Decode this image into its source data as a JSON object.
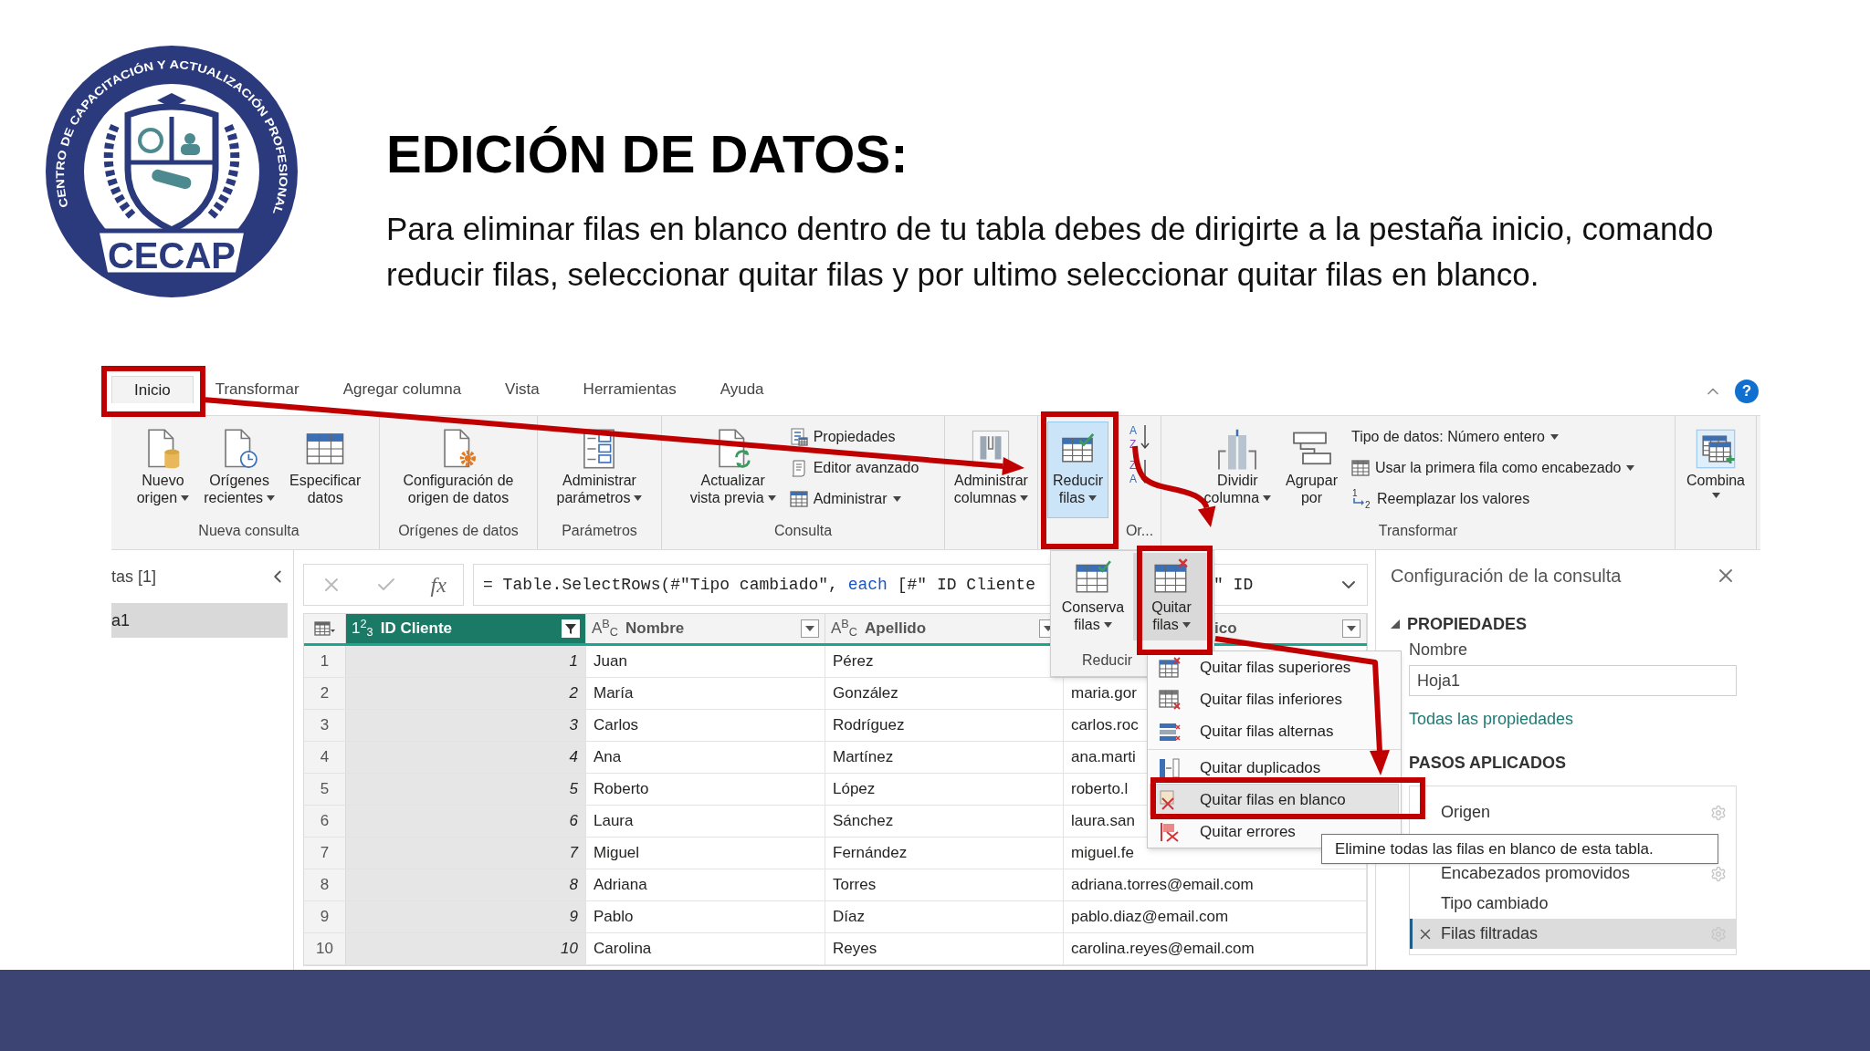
{
  "slide": {
    "title": "EDICIÓN DE DATOS:",
    "body": "Para eliminar filas en blanco dentro de tu tabla debes de dirigirte a la pestaña inicio, comando reducir filas, seleccionar quitar filas y por ultimo seleccionar quitar filas en blanco."
  },
  "logo": {
    "ring_text": "CENTRO DE CAPACITACIÓN Y ACTUALIZACIÓN PROFESIONAL",
    "wordmark": "CECAP"
  },
  "tabs": [
    {
      "label": "Inicio",
      "selected": true
    },
    {
      "label": "Transformar",
      "selected": false
    },
    {
      "label": "Agregar columna",
      "selected": false
    },
    {
      "label": "Vista",
      "selected": false
    },
    {
      "label": "Herramientas",
      "selected": false
    },
    {
      "label": "Ayuda",
      "selected": false
    }
  ],
  "help_label": "?",
  "ribbon": {
    "groups": [
      {
        "kind": "standard",
        "label": "Nueva consulta",
        "buttons": [
          {
            "lines": [
              "Nuevo",
              "origen"
            ],
            "dropdown": true,
            "pressed": false
          },
          {
            "lines": [
              "Orígenes",
              "recientes"
            ],
            "dropdown": true,
            "pressed": false
          },
          {
            "lines": [
              "Especificar",
              "datos"
            ],
            "dropdown": false,
            "pressed": false
          }
        ]
      },
      {
        "kind": "standard",
        "label": "Orígenes de datos",
        "buttons": [
          {
            "lines": [
              "Configuración de",
              "origen de datos"
            ],
            "dropdown": false,
            "pressed": false
          }
        ]
      },
      {
        "kind": "standard",
        "label": "Parámetros",
        "buttons": [
          {
            "lines": [
              "Administrar",
              "parámetros"
            ],
            "dropdown": true,
            "pressed": false
          }
        ]
      },
      {
        "kind": "standard",
        "label": "Consulta",
        "buttons": [
          {
            "lines": [
              "Actualizar",
              "vista previa"
            ],
            "dropdown": true,
            "pressed": false
          }
        ],
        "small_buttons": [
          {
            "label": "Propiedades",
            "dropdown": false
          },
          {
            "label": "Editor avanzado",
            "dropdown": false
          },
          {
            "label": "Administrar",
            "dropdown": true
          }
        ]
      },
      {
        "kind": "standard",
        "buttons": [
          {
            "lines": [
              "Administrar",
              "columnas"
            ],
            "dropdown": true,
            "pressed": false
          }
        ]
      },
      {
        "kind": "standard",
        "buttons": [
          {
            "lines": [
              "Reducir",
              "filas"
            ],
            "dropdown": true,
            "pressed": true
          }
        ]
      },
      {
        "kind": "sort",
        "label": "Or...",
        "letters": [
          "A",
          "Z",
          "Z",
          "A"
        ]
      },
      {
        "kind": "standard",
        "label": "Transformar",
        "buttons": [
          {
            "lines": [
              "Dividir",
              "columna"
            ],
            "dropdown": true,
            "pressed": false
          },
          {
            "lines": [
              "Agrupar",
              "por"
            ],
            "dropdown": false,
            "pressed": false
          }
        ],
        "small_buttons": [
          {
            "label": "Tipo de datos: Número entero",
            "dropdown": true
          },
          {
            "label": "Usar la primera fila como encabezado",
            "dropdown": true
          },
          {
            "label": "Reemplazar los valores",
            "dropdown": false,
            "icon_digits": [
              "1",
              "2"
            ]
          }
        ]
      },
      {
        "kind": "standard",
        "buttons": [
          {
            "lines": [
              "Combina"
            ],
            "dropdown": true,
            "pressed": false
          }
        ]
      }
    ]
  },
  "queries": {
    "header": "tas [1]",
    "items": [
      {
        "label": "a1",
        "selected": true
      }
    ]
  },
  "formula_bar": {
    "fx_label": "fx",
    "before": "= Table.SelectRows(#\"Tipo cambiado\",",
    "keyword": "each",
    "after": "[#\" ID Cliente",
    "tail": "\" ID"
  },
  "table": {
    "columns": [
      {
        "type_label": "1$^{2}$$_{3}$",
        "label": "ID Cliente",
        "selected": true,
        "filtered": true
      },
      {
        "type_label": "A$^{B}$$_{C}$",
        "label": "Nombre",
        "selected": false,
        "filtered": false
      },
      {
        "type_label": "A$^{B}$$_{C}$",
        "label": "Apellido",
        "selected": false,
        "filtered": false
      },
      {
        "label": "ico",
        "selected": false,
        "filtered": false
      }
    ],
    "rows": [
      {
        "number": "1",
        "cells": [
          "1",
          "Juan",
          "Pérez"
        ]
      },
      {
        "number": "2",
        "cells": [
          "2",
          "María",
          "González",
          "maria.gor"
        ]
      },
      {
        "number": "3",
        "cells": [
          "3",
          "Carlos",
          "Rodríguez",
          "carlos.roc"
        ]
      },
      {
        "number": "4",
        "cells": [
          "4",
          "Ana",
          "Martínez",
          "ana.marti"
        ]
      },
      {
        "number": "5",
        "cells": [
          "5",
          "Roberto",
          "López",
          "roberto.l"
        ]
      },
      {
        "number": "6",
        "cells": [
          "6",
          "Laura",
          "Sánchez",
          "laura.san"
        ]
      },
      {
        "number": "7",
        "cells": [
          "7",
          "Miguel",
          "Fernández",
          "miguel.fe"
        ]
      },
      {
        "number": "8",
        "cells": [
          "8",
          "Adriana",
          "Torres",
          "adriana.torres@email.com"
        ]
      },
      {
        "number": "9",
        "cells": [
          "9",
          "Pablo",
          "Díaz",
          "pablo.diaz@email.com"
        ]
      },
      {
        "number": "10",
        "cells": [
          "10",
          "Carolina",
          "Reyes",
          "carolina.reyes@email.com"
        ]
      }
    ]
  },
  "reduce_popout": {
    "buttons": [
      {
        "lines": [
          "Conserva",
          "filas"
        ],
        "dropdown": true,
        "pressed": false
      },
      {
        "lines": [
          "Quitar",
          "filas"
        ],
        "dropdown": true,
        "pressed": true
      }
    ],
    "label": "Reducir"
  },
  "remove_menu": {
    "sections": [
      {
        "items": [
          {
            "label": "Quitar filas superiores",
            "selected": false
          },
          {
            "label": "Quitar filas inferiores",
            "selected": false
          },
          {
            "label": "Quitar filas alternas",
            "selected": false
          }
        ]
      },
      {
        "items": [
          {
            "label": "Quitar duplicados",
            "selected": false
          },
          {
            "label": "Quitar filas en blanco",
            "selected": true
          },
          {
            "label": "Quitar errores",
            "selected": false
          }
        ]
      }
    ]
  },
  "tooltip": "Elimine todas las filas en blanco de esta tabla.",
  "settings": {
    "title": "Configuración de la consulta",
    "properties_heading": "PROPIEDADES",
    "name_label": "Nombre",
    "name_value": "Hoja1",
    "all_properties_link": "Todas las propiedades",
    "steps_heading": "PASOS APLICADOS",
    "steps": [
      {
        "label": "Origen",
        "selected": false,
        "settings": true
      },
      {
        "label": "Encabezados promovidos",
        "selected": false,
        "settings": true
      },
      {
        "label": "Tipo cambiado",
        "selected": false,
        "settings": false
      },
      {
        "label": "Filas filtradas",
        "selected": true,
        "settings": true
      }
    ]
  }
}
